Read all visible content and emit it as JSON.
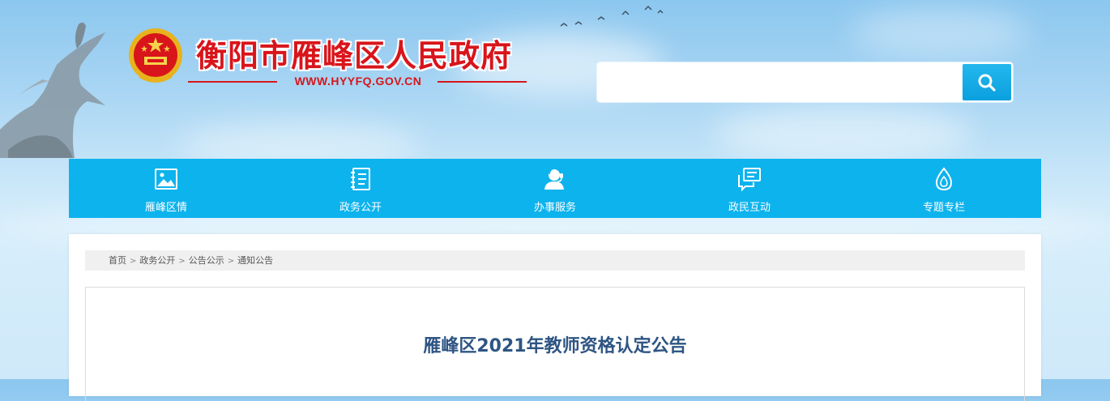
{
  "header": {
    "site_title": "衡阳市雁峰区人民政府",
    "site_url": "WWW.HYYFQ.GOV.CN"
  },
  "search": {
    "placeholder": "",
    "value": ""
  },
  "nav": {
    "items": [
      {
        "label": "雁峰区情",
        "icon": "picture-icon"
      },
      {
        "label": "政务公开",
        "icon": "document-icon"
      },
      {
        "label": "办事服务",
        "icon": "person-service-icon"
      },
      {
        "label": "政民互动",
        "icon": "message-icon"
      },
      {
        "label": "专题专栏",
        "icon": "drop-icon"
      }
    ]
  },
  "breadcrumb": {
    "items": [
      "首页",
      "政务公开",
      "公告公示",
      "通知公告"
    ],
    "separator": ">"
  },
  "article": {
    "title": "雁峰区2021年教师资格认定公告"
  },
  "colors": {
    "nav_bg": "#0db3ed",
    "title_red": "#d8151b",
    "article_title": "#2e5583"
  }
}
